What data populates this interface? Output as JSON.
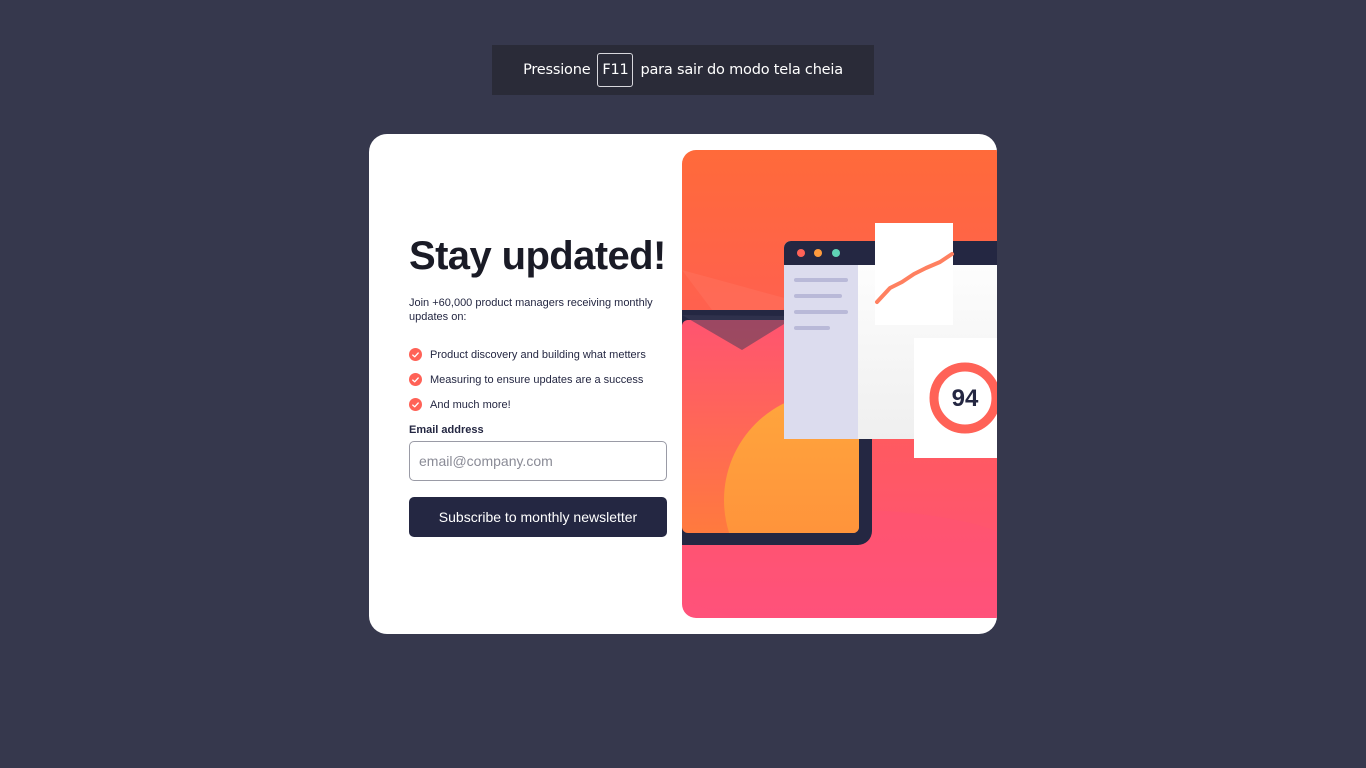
{
  "fullscreen_hint": {
    "prefix": "Pressione",
    "key": "F11",
    "suffix": "para sair do modo tela cheia"
  },
  "signup": {
    "title": "Stay updated!",
    "intro": "Join +60,000 product managers receiving monthly updates on:",
    "features": [
      "Product discovery and building what metters",
      "Measuring to ensure updates are a success",
      "And much more!"
    ],
    "email_label": "Email address",
    "email_value": "",
    "email_placeholder": "email@company.com",
    "submit_label": "Subscribe to monthly newsletter"
  },
  "illustration": {
    "score": "94",
    "window_dots": [
      "red-dot-icon",
      "orange-dot-icon",
      "green-dot-icon"
    ]
  },
  "colors": {
    "background": "#36384d",
    "card": "#ffffff",
    "accent": "#ff6257",
    "dark_navy": "#242742",
    "gradient_top": "#ff6a3a",
    "gradient_bottom": "#ff527b"
  }
}
